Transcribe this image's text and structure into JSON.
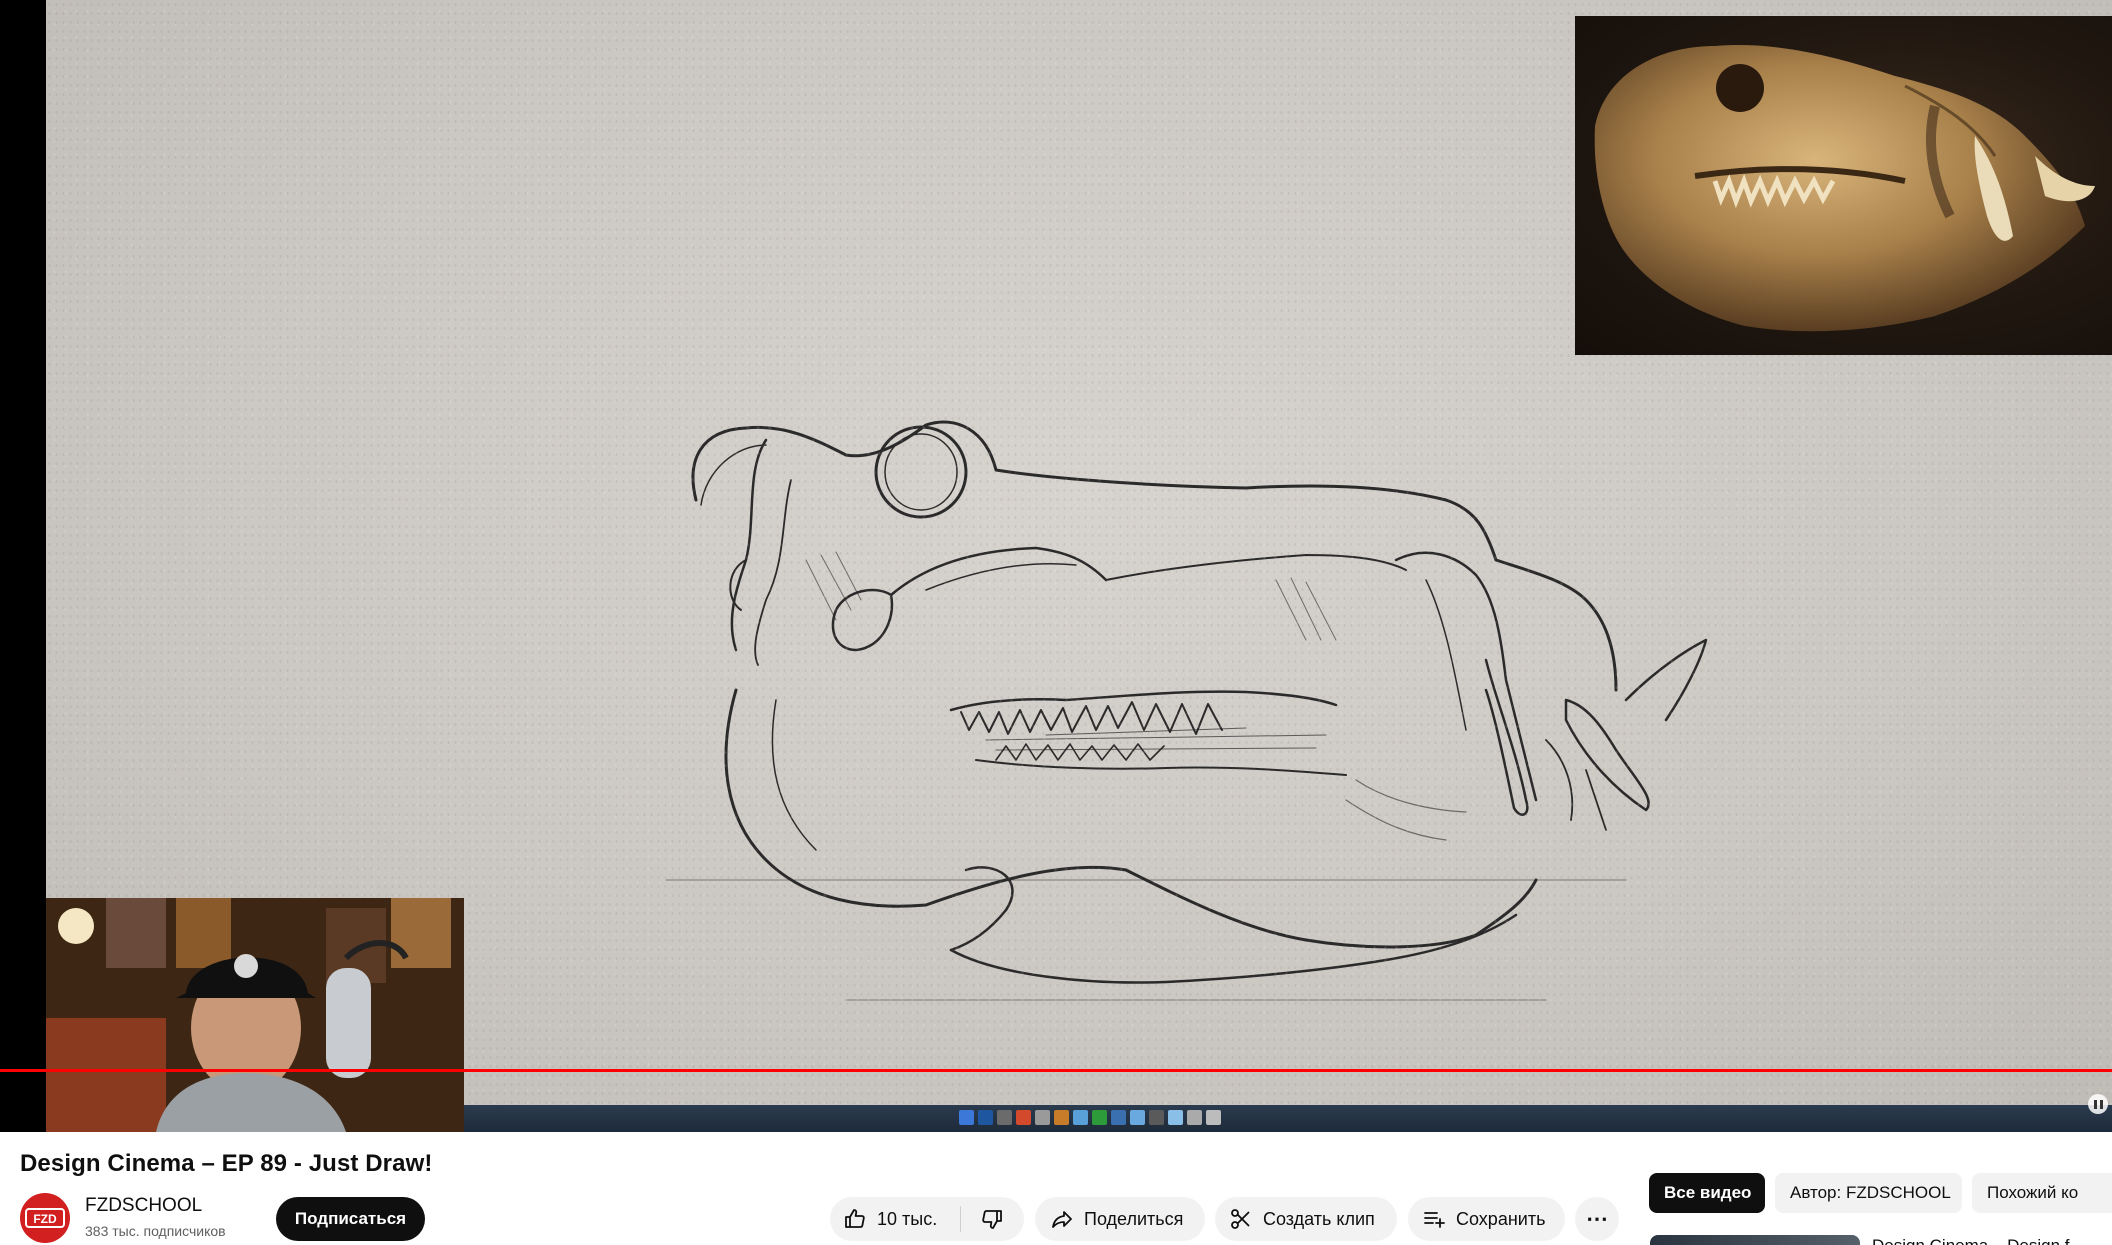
{
  "video": {
    "title": "Design Cinema – EP 89 - Just Draw!",
    "progress_fraction": 1.0
  },
  "channel": {
    "name": "FZDSCHOOL",
    "subscribers": "383 тыс. подписчиков",
    "avatar_text": "FZD",
    "subscribe_label": "Подписаться"
  },
  "actions": {
    "like_count": "10 тыс.",
    "share_label": "Поделиться",
    "clip_label": "Создать клип",
    "save_label": "Сохранить",
    "more_label": "⋯"
  },
  "chips": {
    "all": "Все видео",
    "author": "Автор: FZDSCHOOL",
    "similar": "Похожий ко"
  },
  "related": {
    "first_title": "Design Cinema – Design f"
  },
  "colors": {
    "progress": "#ff0000",
    "subscribe_bg": "#0f0f0f",
    "avatar_bg": "#d21f1f",
    "pill_bg": "#f2f2f2"
  }
}
